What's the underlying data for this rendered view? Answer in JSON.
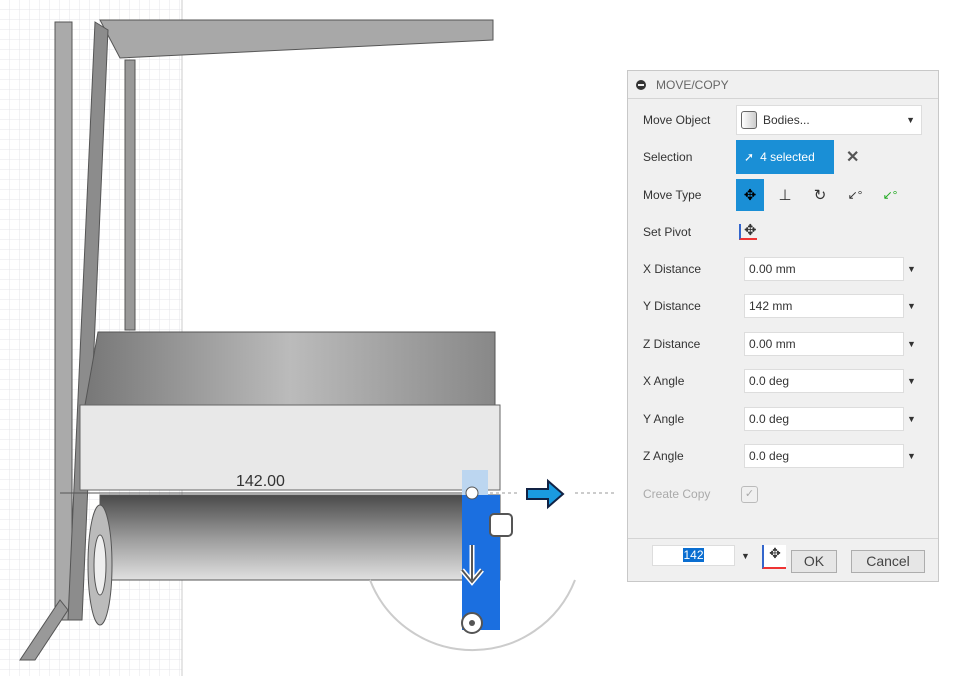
{
  "viewport": {
    "dimension_label": "142.00"
  },
  "dialog": {
    "title": "MOVE/COPY",
    "move_object": {
      "label": "Move Object",
      "value": "Bodies..."
    },
    "selection": {
      "label": "Selection",
      "value": "4 selected"
    },
    "move_type": {
      "label": "Move Type",
      "options": [
        "free-move",
        "translate",
        "rotate",
        "point-to-point",
        "point-to-position"
      ],
      "active": "free-move"
    },
    "set_pivot": {
      "label": "Set Pivot"
    },
    "fields": [
      {
        "label": "X Distance",
        "value": "0.00 mm"
      },
      {
        "label": "Y Distance",
        "value": "142 mm"
      },
      {
        "label": "Z Distance",
        "value": "0.00 mm"
      },
      {
        "label": "X Angle",
        "value": "0.0 deg"
      },
      {
        "label": "Y Angle",
        "value": "0.0 deg"
      },
      {
        "label": "Z Angle",
        "value": "0.0 deg"
      }
    ],
    "create_copy": {
      "label": "Create Copy",
      "checked": true
    },
    "inline_value": "142",
    "ok_label": "OK",
    "cancel_label": "Cancel",
    "accent": "#1a8fd6"
  }
}
